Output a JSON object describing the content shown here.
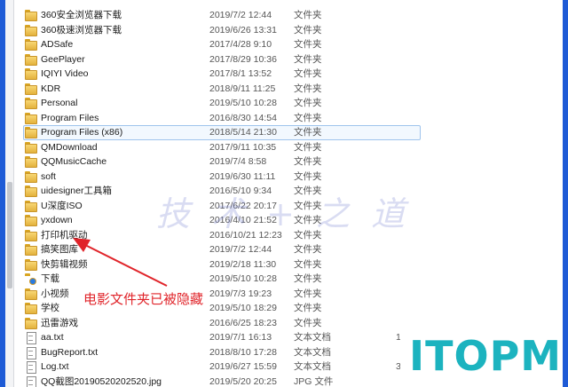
{
  "files": [
    {
      "name": "360安全浏览器下载",
      "date": "2019/7/2 12:44",
      "type": "文件夹",
      "size": "",
      "icon": "folder-icon"
    },
    {
      "name": "360极速浏览器下载",
      "date": "2019/6/26 13:31",
      "type": "文件夹",
      "size": "",
      "icon": "folder-icon"
    },
    {
      "name": "ADSafe",
      "date": "2017/4/28 9:10",
      "type": "文件夹",
      "size": "",
      "icon": "folder-icon"
    },
    {
      "name": "GeePlayer",
      "date": "2017/8/29 10:36",
      "type": "文件夹",
      "size": "",
      "icon": "folder-icon"
    },
    {
      "name": "IQIYI Video",
      "date": "2017/8/1 13:52",
      "type": "文件夹",
      "size": "",
      "icon": "folder-icon"
    },
    {
      "name": "KDR",
      "date": "2018/9/11 11:25",
      "type": "文件夹",
      "size": "",
      "icon": "folder-icon"
    },
    {
      "name": "Personal",
      "date": "2019/5/10 10:28",
      "type": "文件夹",
      "size": "",
      "icon": "folder-icon"
    },
    {
      "name": "Program Files",
      "date": "2016/8/30 14:54",
      "type": "文件夹",
      "size": "",
      "icon": "folder-icon"
    },
    {
      "name": "Program Files (x86)",
      "date": "2018/5/14 21:30",
      "type": "文件夹",
      "size": "",
      "icon": "folder-icon",
      "selected": true
    },
    {
      "name": "QMDownload",
      "date": "2017/9/11 10:35",
      "type": "文件夹",
      "size": "",
      "icon": "folder-icon"
    },
    {
      "name": "QQMusicCache",
      "date": "2019/7/4 8:58",
      "type": "文件夹",
      "size": "",
      "icon": "folder-icon"
    },
    {
      "name": "soft",
      "date": "2019/6/30 11:11",
      "type": "文件夹",
      "size": "",
      "icon": "folder-icon"
    },
    {
      "name": "uidesigner工具箱",
      "date": "2016/5/10 9:34",
      "type": "文件夹",
      "size": "",
      "icon": "folder-icon"
    },
    {
      "name": "U深度ISO",
      "date": "2017/6/22 20:17",
      "type": "文件夹",
      "size": "",
      "icon": "folder-icon"
    },
    {
      "name": "yxdown",
      "date": "2016/4/10 21:52",
      "type": "文件夹",
      "size": "",
      "icon": "folder-icon"
    },
    {
      "name": "打印机驱动",
      "date": "2016/10/21 12:23",
      "type": "文件夹",
      "size": "",
      "icon": "folder-icon"
    },
    {
      "name": "搞笑图库",
      "date": "2019/7/2 12:44",
      "type": "文件夹",
      "size": "",
      "icon": "folder-icon"
    },
    {
      "name": "快剪辑视频",
      "date": "2019/2/18 11:30",
      "type": "文件夹",
      "size": "",
      "icon": "folder-icon"
    },
    {
      "name": "下载",
      "date": "2019/5/10 10:28",
      "type": "文件夹",
      "size": "",
      "icon": "download-icon"
    },
    {
      "name": "小视频",
      "date": "2019/7/3 19:23",
      "type": "文件夹",
      "size": "",
      "icon": "folder-icon"
    },
    {
      "name": "学校",
      "date": "2019/5/10 18:29",
      "type": "文件夹",
      "size": "",
      "icon": "folder-icon"
    },
    {
      "name": "迅雷游戏",
      "date": "2016/6/25 18:23",
      "type": "文件夹",
      "size": "",
      "icon": "folder-icon"
    },
    {
      "name": "aa.txt",
      "date": "2019/7/1 16:13",
      "type": "文本文档",
      "size": "1",
      "icon": "file-icon"
    },
    {
      "name": "BugReport.txt",
      "date": "2018/8/10 17:28",
      "type": "文本文档",
      "size": "",
      "icon": "file-icon"
    },
    {
      "name": "Log.txt",
      "date": "2019/6/27 15:59",
      "type": "文本文档",
      "size": "3",
      "icon": "file-icon"
    },
    {
      "name": "QQ截图20190520202520.jpg",
      "date": "2019/5/20 20:25",
      "type": "JPG 文件",
      "size": "",
      "icon": "file-icon"
    }
  ],
  "annotation_text": "电影文件夹已被隐藏",
  "watermark_text": "技 术 + 之 道",
  "logo_text": "ITOPM",
  "colors": {
    "background": "#1e5bd6",
    "annotation": "#e0242a",
    "logo": "#1cb3bf",
    "selection_border": "#9fc4ec"
  }
}
